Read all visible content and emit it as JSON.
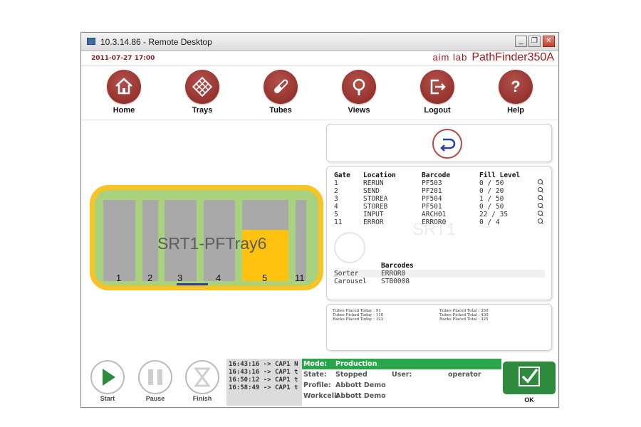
{
  "window": {
    "title": "10.3.14.86 - Remote Desktop",
    "minimize": "_",
    "restore": "❐",
    "close": "✕"
  },
  "header": {
    "datetime": "2011-07-27 17:00",
    "brand_aim": "aim lab",
    "brand_product": "PathFinder350A"
  },
  "nav": [
    {
      "label": "Home",
      "icon": "home-icon"
    },
    {
      "label": "Trays",
      "icon": "tray-grid-icon"
    },
    {
      "label": "Tubes",
      "icon": "tube-icon"
    },
    {
      "label": "Views",
      "icon": "magnifier-icon"
    },
    {
      "label": "Logout",
      "icon": "logout-icon"
    },
    {
      "label": "Help",
      "icon": "question-icon",
      "glyph": "?"
    }
  ],
  "tray": {
    "name": "SRT1-PFTray6",
    "slots": [
      {
        "label": "1",
        "fill": 0
      },
      {
        "label": "2",
        "fill": 0
      },
      {
        "label": "3",
        "fill": 0
      },
      {
        "label": "4",
        "fill": 0
      },
      {
        "label": "5",
        "fill": 0.63
      },
      {
        "label": "11",
        "fill": 0
      }
    ]
  },
  "gates": {
    "headers": {
      "gate": "Gate",
      "location": "Location",
      "barcode": "Barcode",
      "fill": "Fill Level"
    },
    "rows": [
      {
        "gate": "1",
        "location": "RERUN",
        "barcode": "PF503",
        "fill": "0 / 50"
      },
      {
        "gate": "2",
        "location": "SEND",
        "barcode": "PF201",
        "fill": "0 / 20"
      },
      {
        "gate": "3",
        "location": "STOREA",
        "barcode": "PF504",
        "fill": "1 / 50"
      },
      {
        "gate": "4",
        "location": "STOREB",
        "barcode": "PF501",
        "fill": "0 / 50"
      },
      {
        "gate": "5",
        "location": "INPUT",
        "barcode": "ARCH01",
        "fill": "22 / 35"
      },
      {
        "gate": "11",
        "location": "ERROR",
        "barcode": "ERROR0",
        "fill": "0 / 4"
      }
    ],
    "watermark": "SRT1"
  },
  "barcodes": {
    "title": "Barcodes",
    "rows": [
      {
        "label": "Sorter",
        "value": "ERROR0"
      },
      {
        "label": "Carousel",
        "value": "STB0008"
      }
    ]
  },
  "stats": {
    "left": [
      {
        "label": "Tubes Placed Today :",
        "value": "91"
      },
      {
        "label": "Tubes Picked Today :",
        "value": "110"
      },
      {
        "label": "Racks Placed Today :",
        "value": "123"
      }
    ],
    "right": [
      {
        "label": "Tubes Placed Total :",
        "value": "350"
      },
      {
        "label": "Tubes Picked Total :",
        "value": "430"
      },
      {
        "label": "Racks Placed Total :",
        "value": "325"
      }
    ]
  },
  "controls": [
    {
      "label": "Start",
      "icon": "play-icon",
      "color": "#2e8b3e"
    },
    {
      "label": "Pause",
      "icon": "pause-icon",
      "color": "#c9c9c9"
    },
    {
      "label": "Finish",
      "icon": "hourglass-icon",
      "color": "#c9c9c9"
    }
  ],
  "log": [
    "16:43:16 -> CAP1 N",
    "16:43:16 -> CAP1 t",
    "16:50:12 -> CAP1 t",
    "16:58:49 -> CAP1 t"
  ],
  "status": {
    "mode_label": "Mode:",
    "mode_value": "Production",
    "state_label": "State:",
    "state_value": "Stopped",
    "user_label": "User:",
    "user_value": "operator",
    "profile_label": "Profile:",
    "profile_value": "Abbott Demo",
    "workcell_label": "Workcell:",
    "workcell_value": "Abbott Demo"
  },
  "ok": {
    "label": "OK"
  },
  "colors": {
    "accent": "#8a2622",
    "brand": "#a01818",
    "ok": "#2e8b3e",
    "mode": "#2aa54a",
    "tray_outer": "#f7c325",
    "tray_inner": "#a8d27e",
    "slot_fill": "#ffc20e"
  }
}
